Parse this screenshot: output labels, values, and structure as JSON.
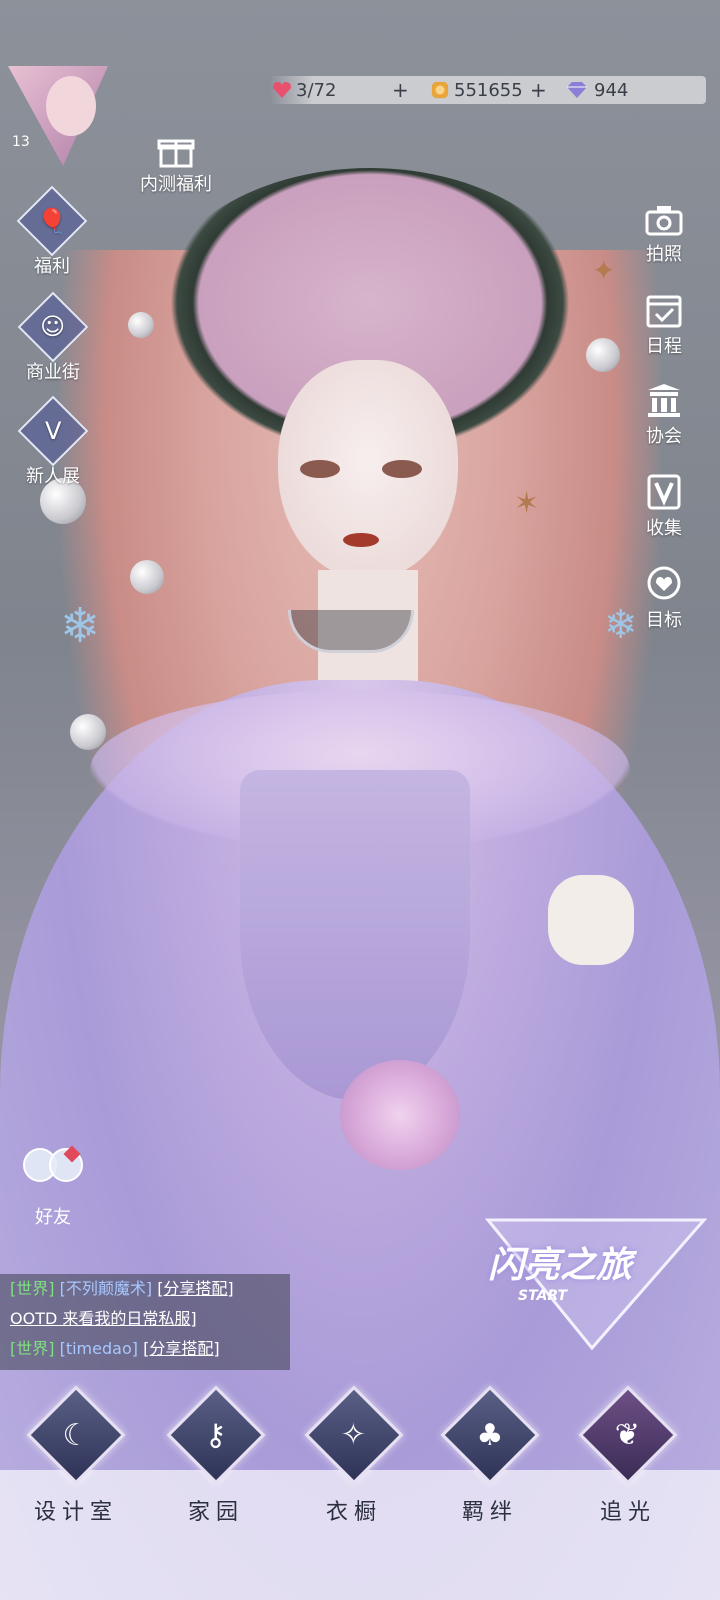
{
  "profile": {
    "level": "13"
  },
  "resources": {
    "stamina": "3/72",
    "gold": "551655",
    "diamonds": "944"
  },
  "left_menu": {
    "beta_gift": "内测福利",
    "welfare": "福利",
    "shop_street": "商业街",
    "newcomer_show": "新人展"
  },
  "right_menu": {
    "photo": "拍照",
    "schedule": "日程",
    "association": "协会",
    "collection": "收集",
    "goals": "目标"
  },
  "friends": {
    "label": "好友"
  },
  "chat": {
    "lines": [
      {
        "tag": "[世界]",
        "user": "[不列颠魔术]",
        "action": "[分享搭配]"
      },
      {
        "text": "OOTD 来看我的日常私服]"
      },
      {
        "tag": "[世界]",
        "user": "[timedao]",
        "action": "[分享搭配]"
      }
    ]
  },
  "event_logo": {
    "title": "闪亮之旅",
    "sub": "START"
  },
  "bottom_nav": [
    {
      "label": "设计室",
      "icon": "moon-icon"
    },
    {
      "label": "家园",
      "icon": "key-icon"
    },
    {
      "label": "衣橱",
      "icon": "crystal-icon"
    },
    {
      "label": "羁绊",
      "icon": "clover-icon"
    },
    {
      "label": "追光",
      "icon": "butterfly-icon"
    }
  ],
  "colors": {
    "stamina_gem": "#e8506e",
    "gold_coin": "#e9a53a",
    "diamond": "#8a7fd6",
    "chat_tag": "#7fe07f",
    "chat_user": "#a7c8ff"
  }
}
